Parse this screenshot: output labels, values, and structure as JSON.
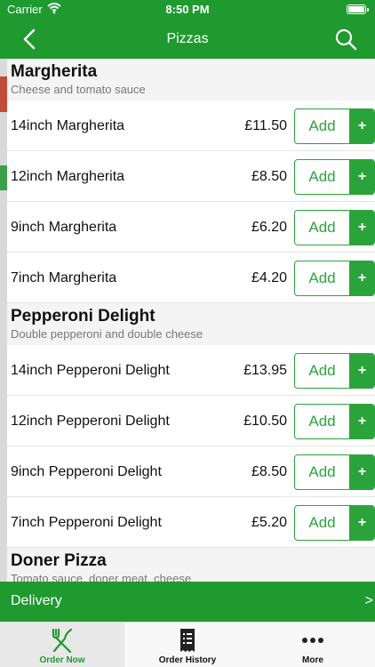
{
  "status_bar": {
    "carrier": "Carrier",
    "time": "8:50 PM"
  },
  "nav": {
    "title": "Pizzas",
    "back_icon": "chevron-left-icon",
    "search_icon": "search-icon"
  },
  "colors": {
    "brand_green": "#1e9a2f",
    "button_green": "#2aa43a"
  },
  "sections": [
    {
      "name": "Margherita",
      "description": "Cheese and tomato sauce",
      "items": [
        {
          "name": "14inch Margherita",
          "price": "£11.50",
          "add_label": "Add",
          "plus": "+"
        },
        {
          "name": "12inch Margherita",
          "price": "£8.50",
          "add_label": "Add",
          "plus": "+"
        },
        {
          "name": "9inch Margherita",
          "price": "£6.20",
          "add_label": "Add",
          "plus": "+"
        },
        {
          "name": "7inch Margherita",
          "price": "£4.20",
          "add_label": "Add",
          "plus": "+"
        }
      ]
    },
    {
      "name": "Pepperoni Delight",
      "description": "Double pepperoni and double cheese",
      "items": [
        {
          "name": "14inch Pepperoni Delight",
          "price": "£13.95",
          "add_label": "Add",
          "plus": "+"
        },
        {
          "name": "12inch Pepperoni Delight",
          "price": "£10.50",
          "add_label": "Add",
          "plus": "+"
        },
        {
          "name": "9inch Pepperoni Delight",
          "price": "£8.50",
          "add_label": "Add",
          "plus": "+"
        },
        {
          "name": "7inch Pepperoni Delight",
          "price": "£5.20",
          "add_label": "Add",
          "plus": "+"
        }
      ]
    },
    {
      "name": "Doner Pizza",
      "description": "Tomato sauce, doner meat, cheese",
      "items": []
    }
  ],
  "delivery": {
    "label": "Delivery",
    "chevron": ">"
  },
  "tabs": [
    {
      "label": "Order Now",
      "icon": "fork-knife-icon",
      "active": true
    },
    {
      "label": "Order History",
      "icon": "receipt-icon",
      "active": false
    },
    {
      "label": "More",
      "icon": "more-dots-icon",
      "active": false
    }
  ]
}
